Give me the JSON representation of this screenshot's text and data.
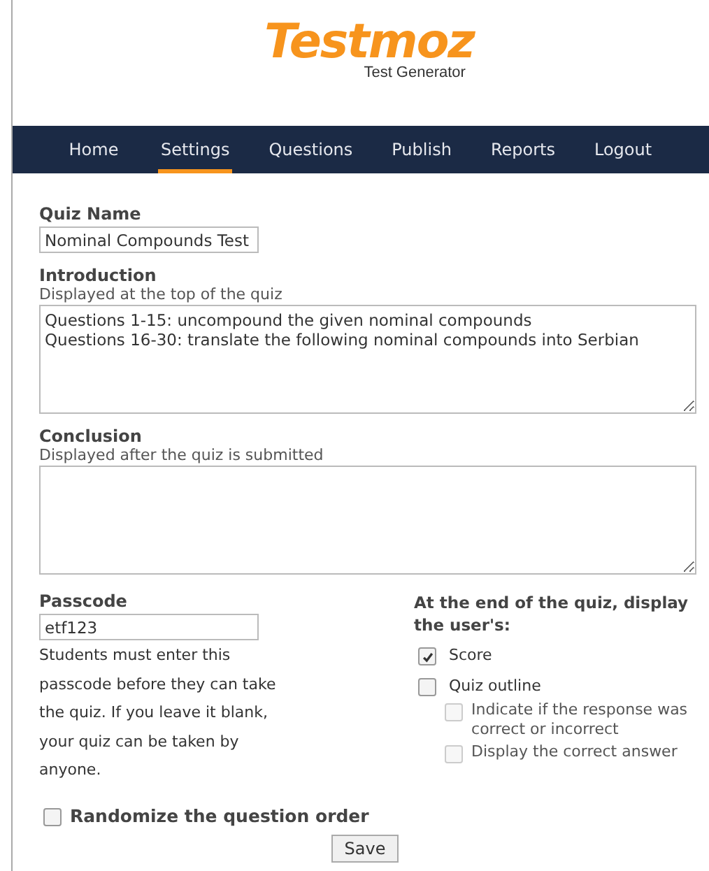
{
  "logo": {
    "title": "Testmoz",
    "subtitle": "Test Generator"
  },
  "nav": [
    {
      "label": "Home",
      "selected": false
    },
    {
      "label": "Settings",
      "selected": true
    },
    {
      "label": "Questions",
      "selected": false
    },
    {
      "label": "Publish",
      "selected": false
    },
    {
      "label": "Reports",
      "selected": false
    },
    {
      "label": "Logout",
      "selected": false
    }
  ],
  "quiz_name": {
    "label": "Quiz Name",
    "value": "Nominal Compounds Test"
  },
  "introduction": {
    "label": "Introduction",
    "hint": "Displayed at the top of the quiz",
    "value": "Questions 1-15: uncompound the given nominal compounds\nQuestions 16-30: translate the following nominal compounds into Serbian"
  },
  "conclusion": {
    "label": "Conclusion",
    "hint": "Displayed after the quiz is submitted"
  },
  "passcode": {
    "label": "Passcode",
    "value": "etf123",
    "help": "Students must enter this passcode before they can take the quiz. If you leave it blank, your quiz can be taken by anyone."
  },
  "display": {
    "heading": "At the end of the quiz, display the user's:",
    "options": [
      {
        "label": "Score",
        "checked": true,
        "disabled": false
      },
      {
        "label": "Quiz outline",
        "checked": false,
        "disabled": false,
        "children": [
          {
            "label": "Indicate if the response was correct or incorrect",
            "checked": false,
            "disabled": true
          },
          {
            "label": "Display the correct answer",
            "checked": false,
            "disabled": true
          }
        ]
      }
    ]
  },
  "randomize": {
    "label": "Randomize the question order",
    "checked": false
  },
  "save_button": "Save"
}
